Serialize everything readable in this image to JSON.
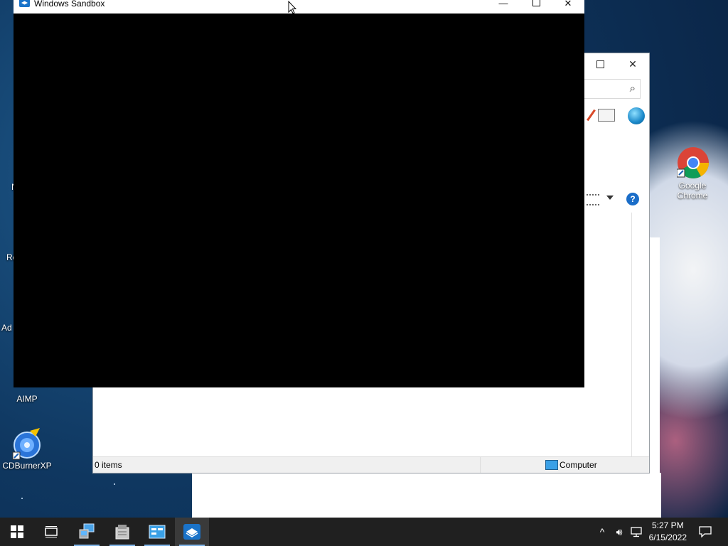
{
  "sandbox": {
    "title": "Windows Sandbox"
  },
  "explorer": {
    "status_items": "0 items",
    "status_location": "Computer"
  },
  "desktop_icons": [
    {
      "label": "Google Chrome",
      "icon": "chrome-icon"
    },
    {
      "label": "AIMP",
      "icon": "aimp-icon"
    },
    {
      "label": "CDBurnerXP",
      "icon": "cdburnerxp-icon"
    }
  ],
  "partial_labels": {
    "re": "Re",
    "ad": "Ad",
    "n": "N"
  },
  "taskbar": {
    "time": "5:27 PM",
    "date": "6/15/2022",
    "icons": [
      "start-icon",
      "task-view-icon",
      "network-computer-icon",
      "file-server-icon",
      "control-panel-icon",
      "windows-sandbox-icon"
    ]
  },
  "colors": {
    "taskbar": "#202020",
    "accent": "#7fb4e8",
    "sandbox_body": "#000000"
  }
}
